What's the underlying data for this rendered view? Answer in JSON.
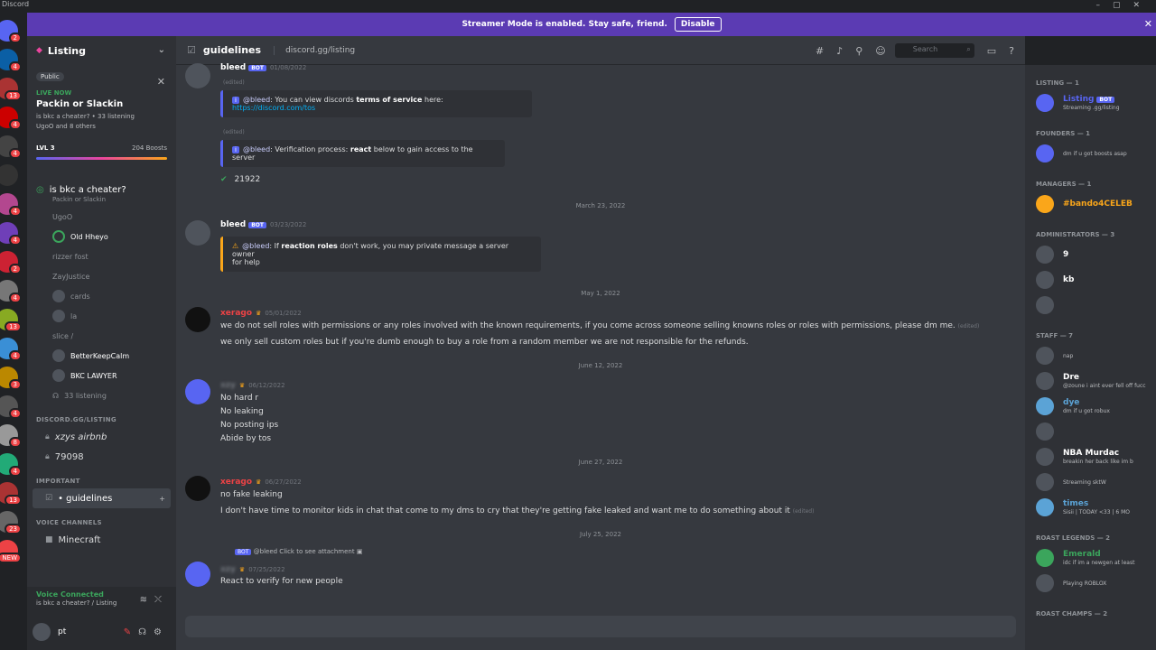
{
  "titlebar": {
    "app": "Discord"
  },
  "banner": {
    "text": "Streamer Mode is enabled. Stay safe, friend.",
    "button": "Disable"
  },
  "rail": {
    "servers": [
      {
        "color": "#5865f2",
        "badge": "2"
      },
      {
        "color": "#0b5fa5",
        "badge": "4"
      },
      {
        "color": "#a33",
        "badge": "13"
      },
      {
        "color": "#c00",
        "badge": "4"
      },
      {
        "color": "#444",
        "badge": "4"
      },
      {
        "color": "#333",
        "badge": ""
      },
      {
        "color": "#b3478f",
        "badge": "4"
      },
      {
        "color": "#6f3fb8",
        "badge": "4"
      },
      {
        "color": "#c23",
        "badge": "2"
      },
      {
        "color": "#777",
        "badge": "4"
      },
      {
        "color": "#8a2",
        "badge": "13"
      },
      {
        "color": "#3a8fd6",
        "badge": "4"
      },
      {
        "color": "#b80",
        "badge": "3"
      },
      {
        "color": "#555",
        "badge": "4"
      },
      {
        "color": "#999",
        "badge": "8"
      },
      {
        "color": "#2a7",
        "badge": "4"
      },
      {
        "color": "#a33",
        "badge": "13"
      },
      {
        "color": "#666",
        "badge": "23"
      },
      {
        "color": "#ed4245",
        "badge": "NEW"
      }
    ]
  },
  "sidebar": {
    "server_name": "Listing",
    "public_label": "Public",
    "live": {
      "tag": "LIVE NOW",
      "title": "Packin or Slackin",
      "sub": "is bkc a cheater? • 33 listening",
      "sub2": "UgoO and 8 others"
    },
    "level": {
      "label": "LVL 3",
      "boosts": "204 Boosts"
    },
    "voice_channel": {
      "name": "is bkc a cheater?",
      "sub": "Packin or Slackin"
    },
    "vc_members": [
      {
        "name": "UgoO",
        "style": "dim"
      },
      {
        "name": "Old Hheyo",
        "style": "ring"
      },
      {
        "name": "rizzer fost",
        "style": "dim"
      },
      {
        "name": "ZayJustice",
        "style": "dim"
      },
      {
        "name": "cards",
        "style": "av"
      },
      {
        "name": "la",
        "style": "av"
      },
      {
        "name": "slice /",
        "style": "dim"
      },
      {
        "name": "BetterKeepCalm",
        "style": "bright"
      },
      {
        "name": "BKC LAWYER",
        "style": "bright"
      },
      {
        "name": "33 listening",
        "style": "listen"
      }
    ],
    "categories": {
      "listing": "DISCORD.GG/LISTING",
      "important": "IMPORTANT",
      "voice": "VOICE CHANNELS"
    },
    "listing_channels": [
      {
        "name": "xzys airbnb"
      },
      {
        "name": "79098"
      }
    ],
    "important_channels": [
      {
        "name": "• guidelines"
      }
    ],
    "voice_channels": [
      {
        "name": "Minecraft"
      }
    ],
    "vc_status": {
      "title": "Voice Connected",
      "sub": "is bkc a cheater? / Listing"
    },
    "user": {
      "name": "pt"
    }
  },
  "chat": {
    "channel": "guidelines",
    "topic": "discord.gg/listing",
    "search_placeholder": "Search",
    "messages": [
      {
        "author": "bleed",
        "bot": true,
        "date": "01/08/2022"
      },
      {
        "author": "bleed",
        "bot": true,
        "date": "03/23/2022"
      },
      {
        "author": "xerago",
        "date": "05/01/2022"
      },
      {
        "author": "xzy",
        "date": "06/12/2022"
      },
      {
        "author": "xerago",
        "date": "06/27/2022"
      },
      {
        "author": "xzy",
        "date": "07/25/2022"
      }
    ],
    "embeds": {
      "tos_mention": "@bleed",
      "tos_text1": ": You can view discords ",
      "tos_bold": "terms of service",
      "tos_text2": " here: ",
      "tos_link": "https://discord.com/tos",
      "verify_mention": "@bleed",
      "verify_text1": ": Verification process: ",
      "verify_bold": "react",
      "verify_text2": " below to gain access to the server",
      "roles_mention": "@bleed",
      "roles_text1": ": If ",
      "roles_bold": "reaction roles",
      "roles_text2": " don't work, you may private message a server owner",
      "roles_text3": "for help",
      "info_icon": "i",
      "warn_icon": "⚠",
      "edited": "(edited)"
    },
    "reaction_count": "21922",
    "dividers": [
      "March 23, 2022",
      "May 1, 2022",
      "June 12, 2022",
      "June 27, 2022",
      "July 25, 2022"
    ],
    "lines": {
      "l1": "we do not sell roles with permissions or any roles involved with the known requirements, if you come across someone selling knowns roles or roles with permissions, please dm me.",
      "l2": "we only sell custom roles but if you're dumb enough to buy a role from a random member we are not responsible for the refunds.",
      "l3": "No hard r",
      "l4": "No leaking",
      "l5": "No posting ips",
      "l6": "Abide by tos",
      "l7": "no fake leaking",
      "l8": "I don't have time to monitor kids in chat that come to my dms to cry that they're getting fake leaked and want me to do something about it",
      "reply": "@bleed Click to see attachment",
      "l9": "React to verify for new people"
    },
    "edited_tag": "(edited)",
    "bot_tag": "BOT"
  },
  "members": {
    "categories": [
      {
        "label": "LISTING — 1",
        "rows": [
          {
            "name": "Listing",
            "status": "Streaming .gg/listing",
            "bot": true,
            "color": "#5865f2"
          }
        ]
      },
      {
        "label": "FOUNDERS — 1",
        "rows": [
          {
            "name": "",
            "status": "dm if u got boosts asap",
            "color": "#5865f2"
          }
        ]
      },
      {
        "label": "MANAGERS — 1",
        "rows": [
          {
            "name": "#bando4CELEB",
            "status": "",
            "color": "#faa61a"
          }
        ]
      },
      {
        "label": "ADMINISTRATORS — 3",
        "rows": [
          {
            "name": "9",
            "status": ""
          },
          {
            "name": "kb",
            "status": ""
          },
          {
            "name": "",
            "status": ""
          }
        ]
      },
      {
        "label": "STAFF — 7",
        "rows": [
          {
            "name": "",
            "status": "nap"
          },
          {
            "name": "Dre",
            "status": "@zoune i aint ever fell off fucc"
          },
          {
            "name": "dye",
            "status": "dm if u got robux",
            "color": "#5ba3d6"
          },
          {
            "name": "",
            "status": ""
          },
          {
            "name": "NBA Murdac",
            "status": "breakin her back like im b"
          },
          {
            "name": "",
            "status": "Streaming sktW"
          },
          {
            "name": "times",
            "status": "Sisii | TODAY <33 | 6 MO",
            "color": "#5ba3d6"
          }
        ]
      },
      {
        "label": "ROAST LEGENDS — 2",
        "rows": [
          {
            "name": "Emerald",
            "status": "idc if im a newgen at least",
            "color": "#3ba55c"
          },
          {
            "name": "",
            "status": "Playing ROBLOX"
          }
        ]
      },
      {
        "label": "ROAST CHAMPS — 2",
        "rows": []
      }
    ]
  }
}
